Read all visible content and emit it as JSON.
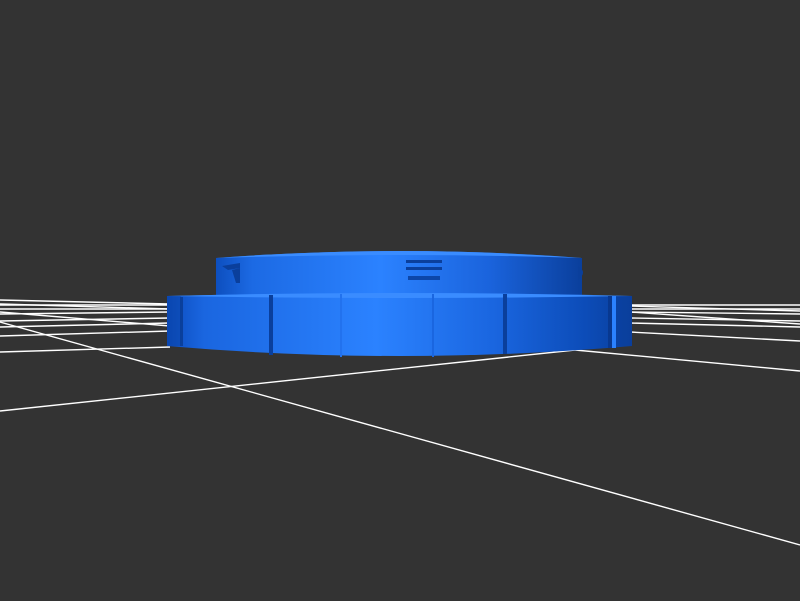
{
  "viewport": {
    "background_color": "#333333",
    "grid_color": "#ffffff",
    "model_color": "#1f6fe6",
    "model_dark_color": "#0a3f9c",
    "model_light_color": "#3a8cff"
  }
}
